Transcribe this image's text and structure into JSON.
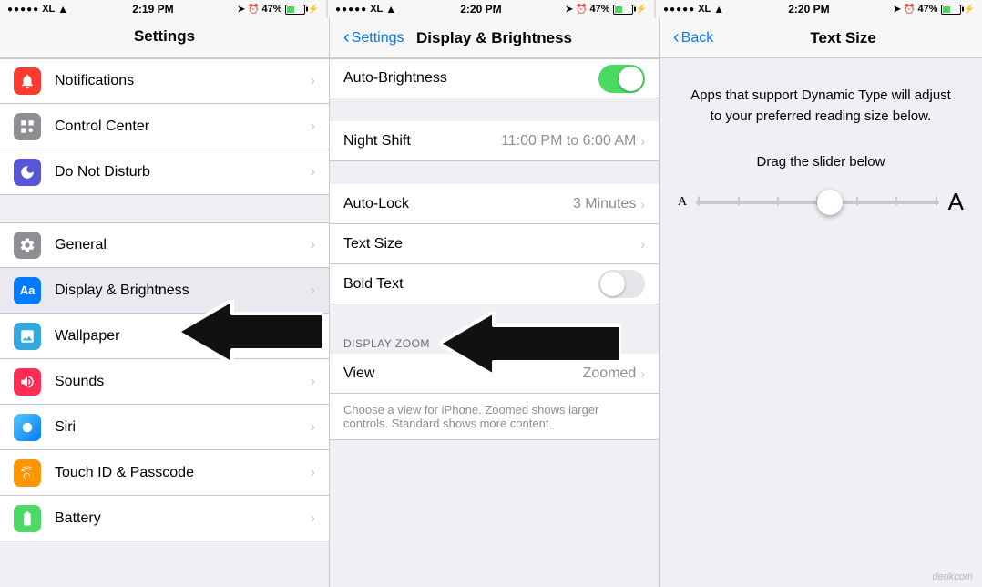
{
  "panels": {
    "panel1": {
      "header": "Settings",
      "items": [
        {
          "id": "notifications",
          "label": "Notifications",
          "iconClass": "icon-notifications",
          "iconSymbol": "🔔"
        },
        {
          "id": "control-center",
          "label": "Control Center",
          "iconClass": "icon-control",
          "iconSymbol": "⚙"
        },
        {
          "id": "do-not-disturb",
          "label": "Do Not Disturb",
          "iconClass": "icon-dnd",
          "iconSymbol": "🌙"
        },
        {
          "id": "general",
          "label": "General",
          "iconClass": "icon-general",
          "iconSymbol": "⚙"
        },
        {
          "id": "display",
          "label": "Display & Brightness",
          "iconClass": "icon-display",
          "iconSymbol": "Aa"
        },
        {
          "id": "wallpaper",
          "label": "Wallpaper",
          "iconClass": "icon-wallpaper",
          "iconSymbol": "🌸"
        },
        {
          "id": "sounds",
          "label": "Sounds",
          "iconClass": "icon-sounds",
          "iconSymbol": "🔊"
        },
        {
          "id": "siri",
          "label": "Siri",
          "iconClass": "icon-siri",
          "iconSymbol": "◎"
        },
        {
          "id": "touchid",
          "label": "Touch ID & Passcode",
          "iconClass": "icon-touchid",
          "iconSymbol": "👆"
        },
        {
          "id": "battery",
          "label": "Battery",
          "iconClass": "icon-battery",
          "iconSymbol": "🔋"
        }
      ]
    },
    "panel2": {
      "back_label": "Settings",
      "title": "Display & Brightness",
      "items": [
        {
          "id": "auto-brightness",
          "label": "Auto-Brightness",
          "type": "toggle",
          "value": true
        },
        {
          "id": "night-shift",
          "label": "Night Shift",
          "type": "nav",
          "value": "11:00 PM to 6:00 AM"
        },
        {
          "id": "auto-lock",
          "label": "Auto-Lock",
          "type": "nav",
          "value": "3 Minutes"
        },
        {
          "id": "text-size",
          "label": "Text Size",
          "type": "nav",
          "value": ""
        },
        {
          "id": "bold-text",
          "label": "Bold Text",
          "type": "toggle",
          "value": false
        }
      ],
      "section_display_zoom": "DISPLAY ZOOM",
      "zoom_view_label": "View",
      "zoom_view_value": "Zoomed",
      "zoom_description": "Choose a view for iPhone. Zoomed shows larger controls. Standard shows more content."
    },
    "panel3": {
      "back_label": "Back",
      "title": "Text Size",
      "description": "Apps that support Dynamic Type will adjust to your preferred reading size below.",
      "drag_label": "Drag the slider below",
      "slider_small_a": "A",
      "slider_large_a": "A"
    }
  },
  "status_bars": [
    {
      "carrier": "●●●●● XL",
      "wifi": true,
      "time": "2:19 PM",
      "location": true,
      "alarm": true,
      "battery_pct": "47%",
      "charging": true
    },
    {
      "carrier": "●●●●● XL",
      "wifi": true,
      "time": "2:20 PM",
      "location": true,
      "alarm": true,
      "battery_pct": "47%",
      "charging": true
    },
    {
      "carrier": "●●●●● XL",
      "wifi": true,
      "time": "2:20 PM",
      "location": true,
      "alarm": true,
      "battery_pct": "47%",
      "charging": true
    }
  ],
  "watermark": "derikcom"
}
